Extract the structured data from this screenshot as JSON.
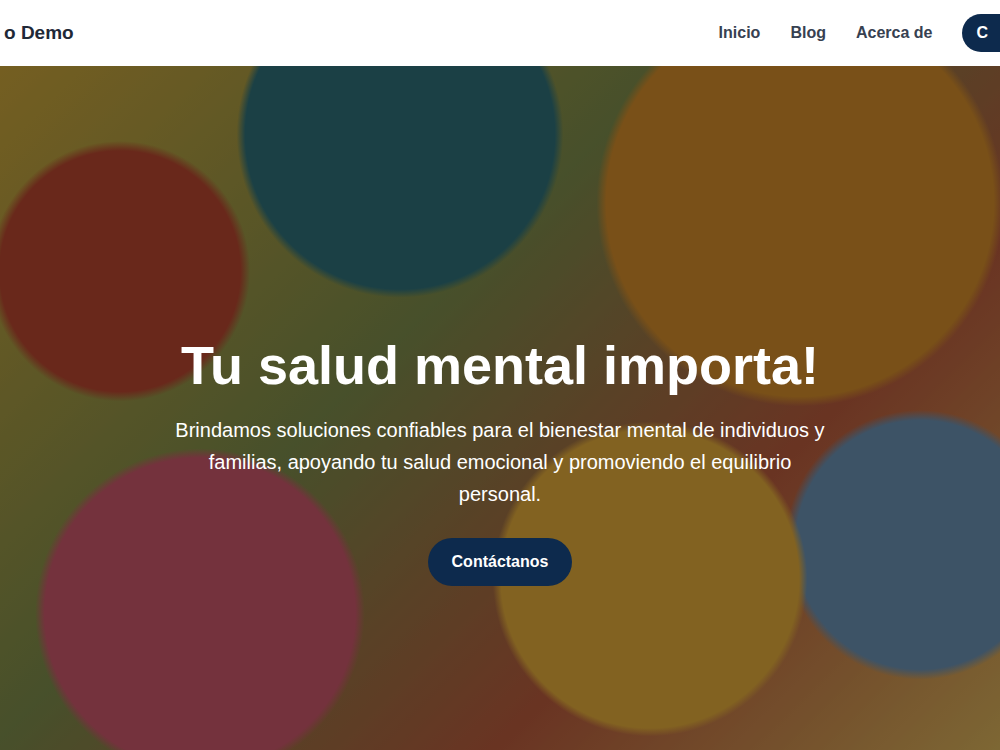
{
  "header": {
    "logo": "o Demo",
    "nav": [
      "Inicio",
      "Blog",
      "Acerca de"
    ],
    "cta": "C"
  },
  "hero": {
    "title": "Tu salud mental importa!",
    "subtitle": "Brindamos soluciones confiables para el bienestar mental de individuos y familias, apoyando tu salud emocional y promoviendo el equilibrio personal.",
    "button": "Contáctanos"
  }
}
